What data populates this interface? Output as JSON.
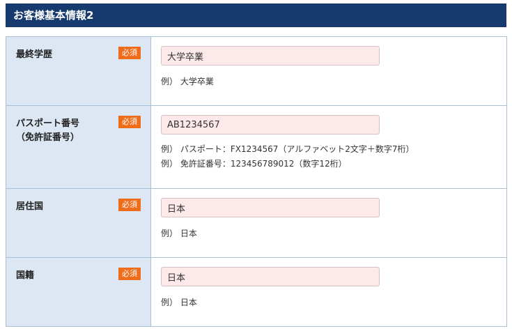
{
  "header": {
    "title": "お客様基本情報2"
  },
  "required_badge": "必須",
  "rows": [
    {
      "label": "最終学歴",
      "value": "大学卒業",
      "examples": [
        "例） 大学卒業"
      ]
    },
    {
      "label": "パスポート番号",
      "sublabel": "（免許証番号）",
      "value": "AB1234567",
      "examples": [
        "例） パスポート：FX1234567（アルファベット2文字＋数字7桁）",
        "例） 免許証番号：123456789012（数字12桁）"
      ]
    },
    {
      "label": "居住国",
      "value": "日本",
      "examples": [
        "例） 日本"
      ]
    },
    {
      "label": "国籍",
      "value": "日本",
      "examples": [
        "例） 日本"
      ]
    }
  ]
}
